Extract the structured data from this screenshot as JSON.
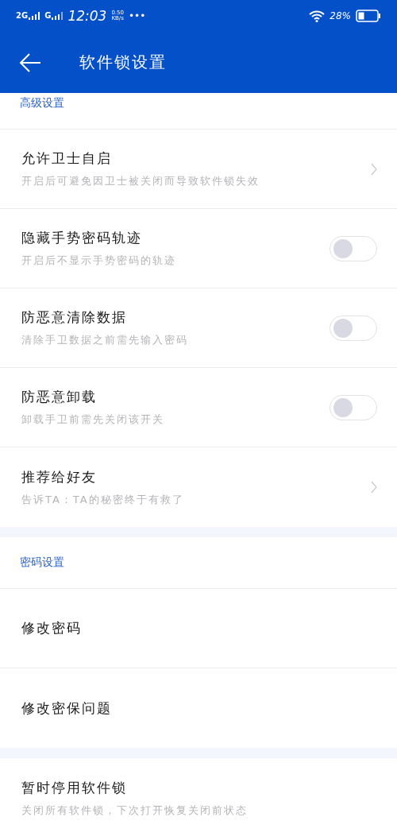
{
  "status_bar": {
    "sim1": "2G",
    "sim2": "G",
    "time": "12:03",
    "speed_value": "0.50",
    "speed_unit": "KB/s",
    "more": "•••",
    "battery": "28%"
  },
  "toolbar": {
    "title": "软件锁设置"
  },
  "sections": [
    {
      "title": "高级设置",
      "items": [
        {
          "kind": "link",
          "title": "允许卫士自启",
          "subtitle": "开启后可避免因卫士被关闭而导致软件锁失效"
        },
        {
          "kind": "toggle",
          "title": "隐藏手势密码轨迹",
          "subtitle": "开启后不显示手势密码的轨迹",
          "on": false
        },
        {
          "kind": "toggle",
          "title": "防恶意清除数据",
          "subtitle": "清除手卫数据之前需先输入密码",
          "on": false
        },
        {
          "kind": "toggle",
          "title": "防恶意卸载",
          "subtitle": "卸载手卫前需先关闭该开关",
          "on": false
        },
        {
          "kind": "link",
          "title": "推荐给好友",
          "subtitle": "告诉TA：TA的秘密终于有救了"
        }
      ]
    },
    {
      "title": "密码设置",
      "items": [
        {
          "kind": "plain",
          "title": "修改密码"
        },
        {
          "kind": "plain",
          "title": "修改密保问题"
        }
      ]
    },
    {
      "items": [
        {
          "kind": "plain",
          "title": "暂时停用软件锁",
          "subtitle": "关闭所有软件锁，下次打开恢复关闭前状态"
        }
      ]
    }
  ]
}
